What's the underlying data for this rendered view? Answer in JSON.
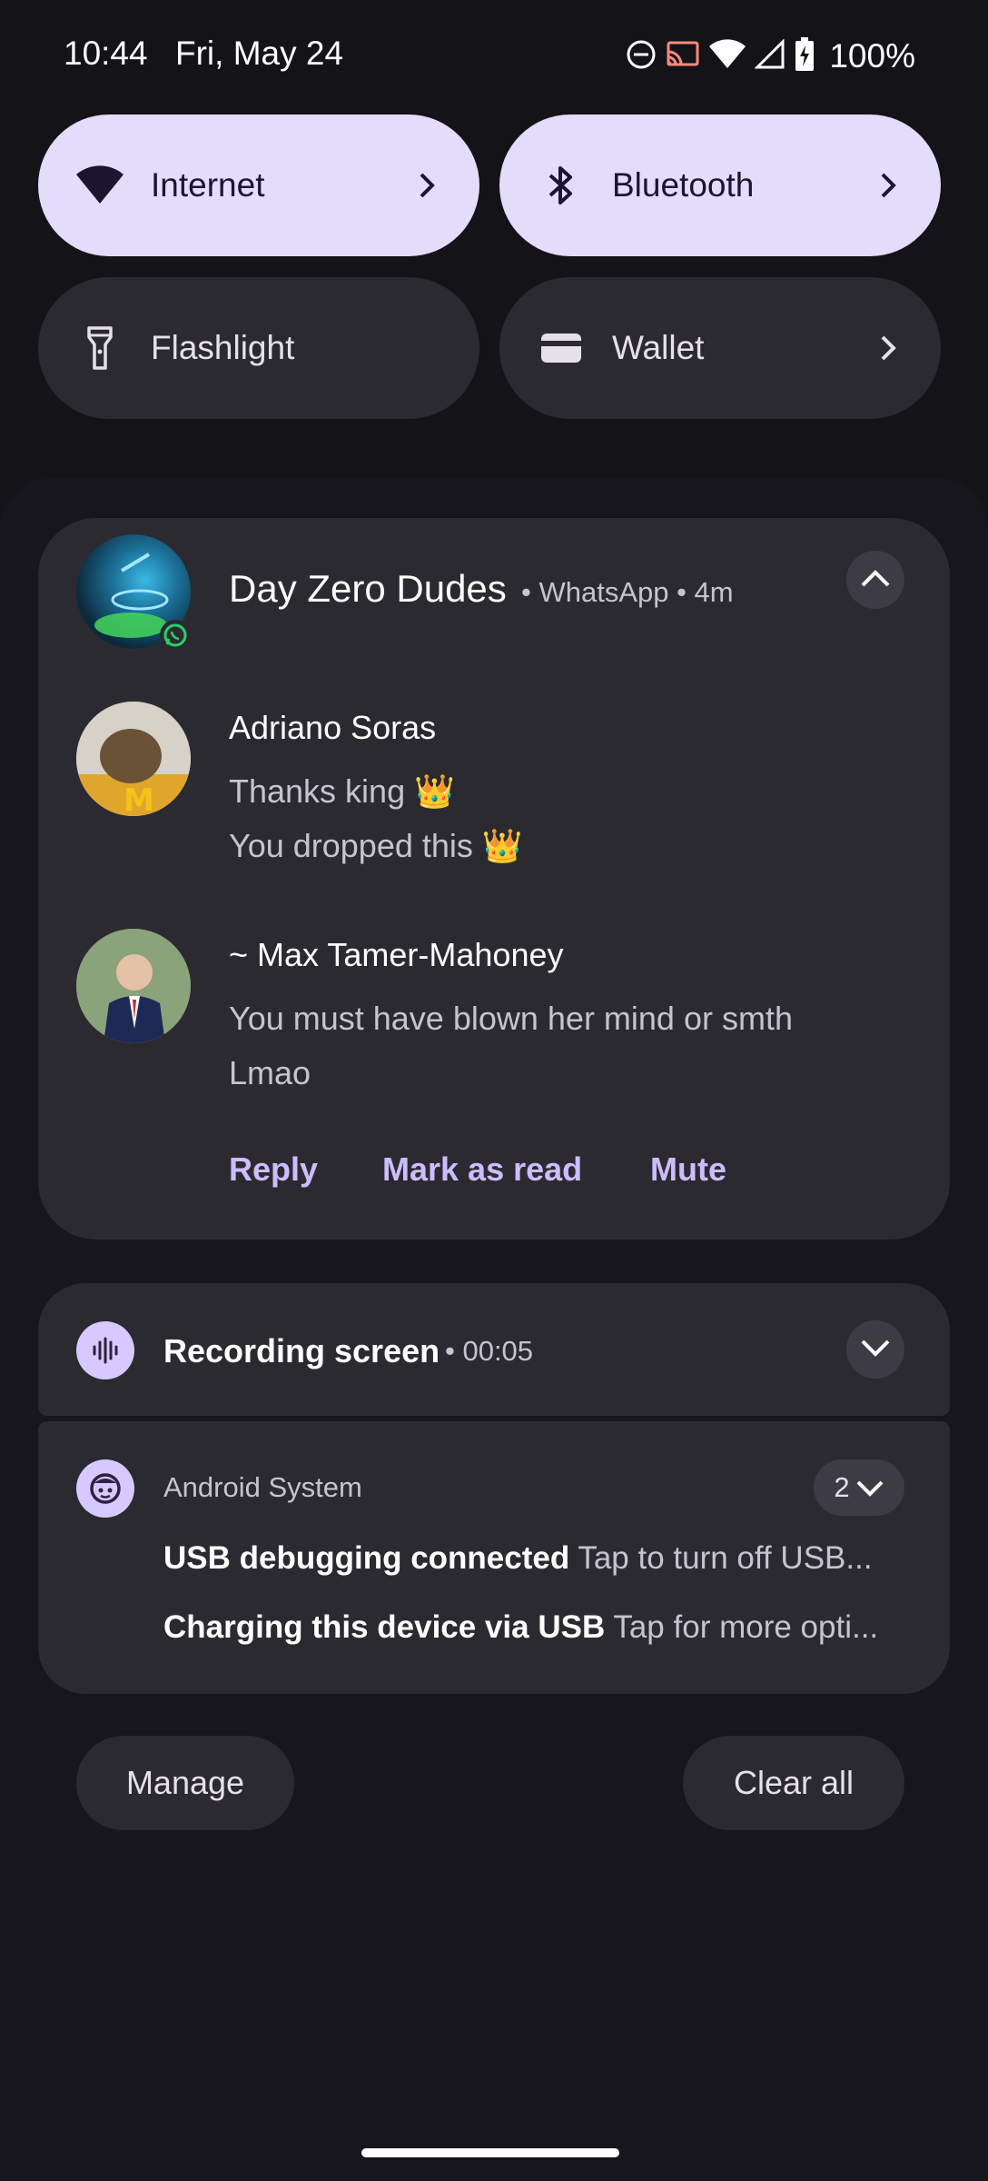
{
  "status_bar": {
    "time": "10:44",
    "date": "Fri, May 24",
    "battery": "100%",
    "icons": [
      "do-not-disturb-icon",
      "cast-icon",
      "wifi-icon",
      "cellular-signal-icon",
      "battery-charging-icon"
    ]
  },
  "quick_settings": {
    "tiles": [
      {
        "label": "Internet",
        "icon": "wifi-icon",
        "state": "on"
      },
      {
        "label": "Bluetooth",
        "icon": "bluetooth-icon",
        "state": "on"
      },
      {
        "label": "Flashlight",
        "icon": "flashlight-icon",
        "state": "off"
      },
      {
        "label": "Wallet",
        "icon": "wallet-icon",
        "state": "off"
      }
    ]
  },
  "whatsapp_group": {
    "title": "Day Zero Dudes",
    "app": "WhatsApp",
    "age": "4m",
    "meta": "• WhatsApp • 4m",
    "messages": [
      {
        "sender": "Adriano Soras",
        "lines": [
          "Thanks king 👑",
          "You dropped this 👑"
        ]
      },
      {
        "sender": "~ Max Tamer-Mahoney",
        "lines": [
          "You must have blown her mind or smth",
          "Lmao"
        ]
      }
    ],
    "actions": {
      "reply": "Reply",
      "mark_read": "Mark as read",
      "mute": "Mute"
    }
  },
  "recording": {
    "title": "Recording screen",
    "time": "• 00:05"
  },
  "android_system": {
    "app": "Android System",
    "count": "2",
    "items": [
      {
        "title": "USB debugging connected",
        "text": "Tap to turn off USB..."
      },
      {
        "title": "Charging this device via USB",
        "text": "Tap for more opti..."
      }
    ]
  },
  "footer": {
    "manage": "Manage",
    "clear_all": "Clear all"
  },
  "colors": {
    "background": "#131318",
    "tile_on": "#e4dcfb",
    "tile_off": "#2b2a31",
    "card": "#2b2a31",
    "accent": "#cdbdff",
    "whatsapp_green": "#25d366"
  }
}
